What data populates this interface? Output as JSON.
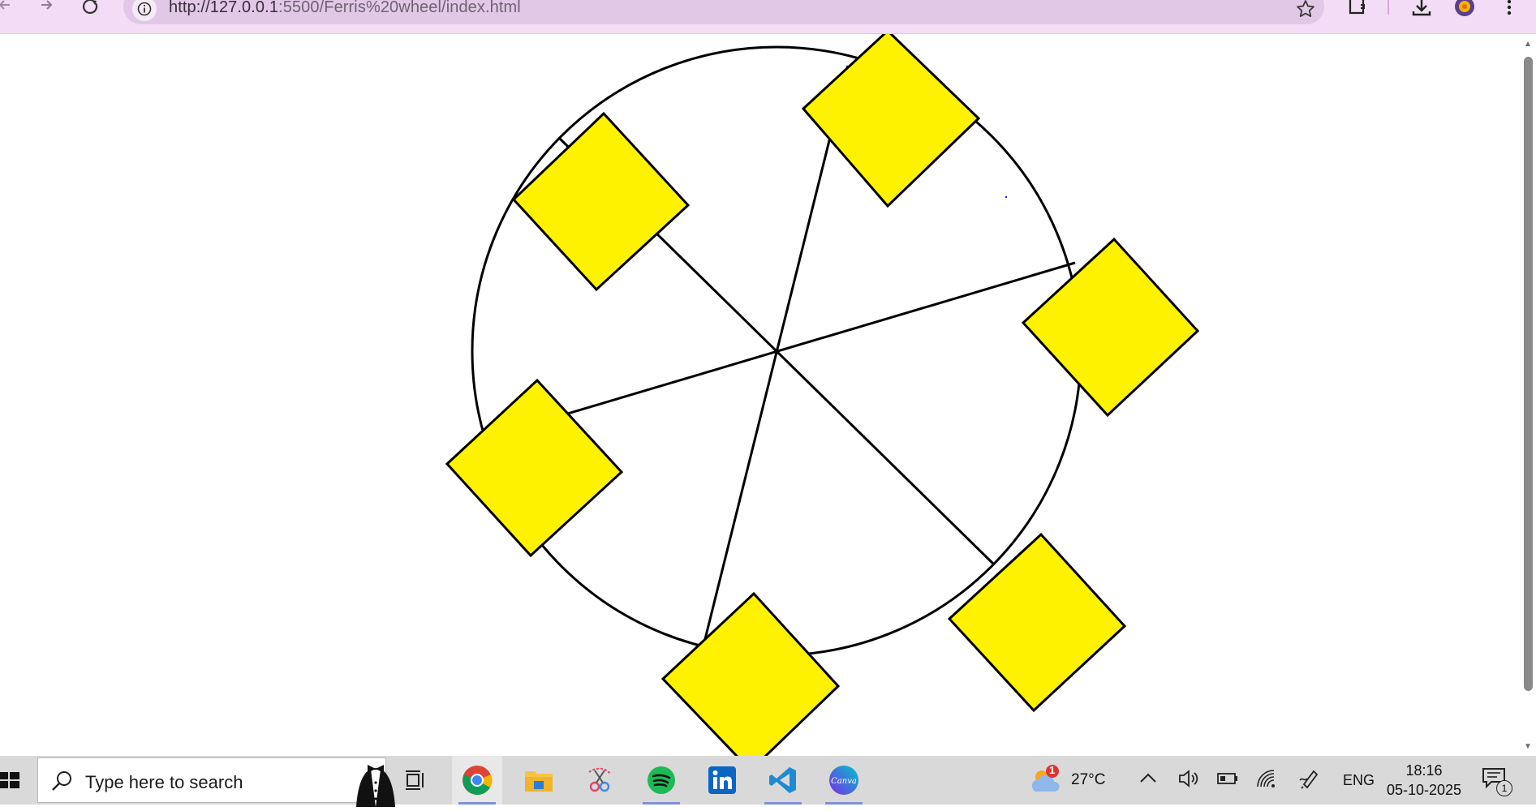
{
  "browser": {
    "url_host": "http://127.0.0.1",
    "url_rest": ":5500/Ferris%20wheel/index.html"
  },
  "taskbar": {
    "search_placeholder": "Type here to search",
    "weather_temp": "27°C",
    "weather_badge": "1",
    "language": "ENG",
    "time": "18:16",
    "date": "05-10-2025",
    "notification_count": "1"
  },
  "colors": {
    "cabin_fill": "#fff200",
    "stroke": "#000000",
    "toolbar_bg": "#f3dcf5",
    "taskbar_bg": "#d9d9d9"
  }
}
